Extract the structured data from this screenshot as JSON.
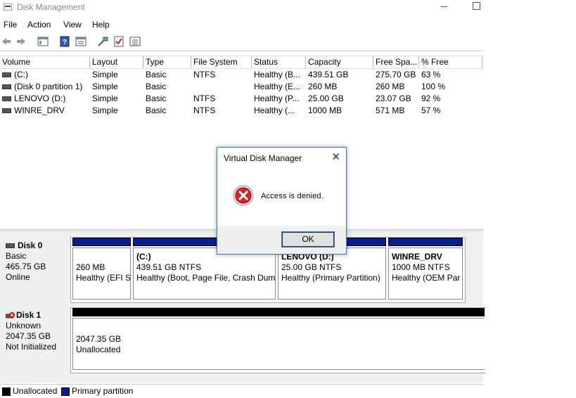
{
  "window": {
    "title": "Disk Management"
  },
  "menu": [
    "File",
    "Action",
    "View",
    "Help"
  ],
  "toolbar": [
    "back-icon",
    "forward-icon",
    "console-tree-icon",
    "help-icon",
    "properties-icon",
    "connect-icon",
    "checklist-icon",
    "list-icon"
  ],
  "volume_table": {
    "columns": [
      "Volume",
      "Layout",
      "Type",
      "File System",
      "Status",
      "Capacity",
      "Free Spa...",
      "% Free"
    ],
    "rows": [
      [
        "(C:)",
        "Simple",
        "Basic",
        "NTFS",
        "Healthy (B...",
        "439.51 GB",
        "275.70 GB",
        "63 %"
      ],
      [
        "(Disk 0 partition 1)",
        "Simple",
        "Basic",
        "",
        "Healthy (E...",
        "260 MB",
        "260 MB",
        "100 %"
      ],
      [
        "LENOVO (D:)",
        "Simple",
        "Basic",
        "NTFS",
        "Healthy (P...",
        "25.00 GB",
        "23.07 GB",
        "92 %"
      ],
      [
        "WINRE_DRV",
        "Simple",
        "Basic",
        "NTFS",
        "Healthy (...",
        "1000 MB",
        "571 MB",
        "57 %"
      ]
    ]
  },
  "disks": [
    {
      "name": "Disk 0",
      "type": "Basic",
      "size": "465.75 GB",
      "state": "Online",
      "partitions": [
        {
          "label": "",
          "line1": "260 MB",
          "line2": "Healthy (EFI S"
        },
        {
          "label": "(C:)",
          "line1": "439.51 GB NTFS",
          "line2": "Healthy (Boot, Page File, Crash Dum"
        },
        {
          "label": "LENOVO  (D:)",
          "line1": "25.00 GB NTFS",
          "line2": "Healthy (Primary Partition)"
        },
        {
          "label": "WINRE_DRV",
          "line1": "1000 MB NTFS",
          "line2": "Healthy (OEM Par"
        }
      ]
    },
    {
      "name": "Disk 1",
      "type": "Unknown",
      "size": "2047.35 GB",
      "state": "Not Initialized",
      "partitions": [
        {
          "label": "",
          "line1": "2047.35 GB",
          "line2": "Unallocated"
        }
      ]
    }
  ],
  "legend": [
    {
      "label": "Unallocated",
      "color": "#000000"
    },
    {
      "label": "Primary partition",
      "color": "#0a1d8c"
    }
  ],
  "dialog": {
    "title": "Virtual Disk Manager",
    "message": "Access is denied.",
    "ok_label": "OK"
  }
}
